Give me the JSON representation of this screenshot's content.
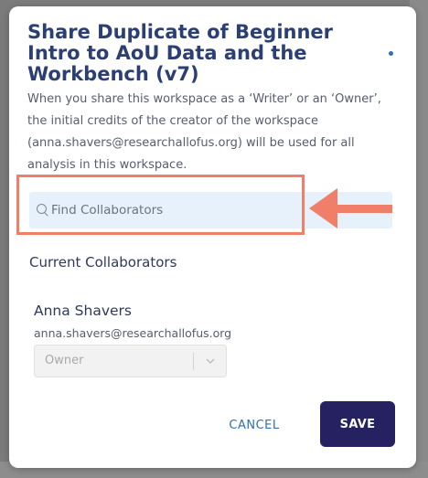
{
  "modal": {
    "title": "Share Duplicate of Beginner Intro to AoU Data and the Workbench (v7)",
    "description": "When you share this workspace as a ‘Writer’ or an ‘Owner’, the initial credits of the creator of the workspace (anna.shavers@researchallofus.org) will be used for all analysis in this workspace.",
    "search": {
      "placeholder": "Find Collaborators",
      "value": ""
    },
    "current_collaborators_heading": "Current Collaborators",
    "collaborators": [
      {
        "name": "Anna Shavers",
        "email": "anna.shavers@researchallofus.org",
        "role": "Owner"
      }
    ],
    "cancel_label": "CANCEL",
    "save_label": "SAVE"
  },
  "colors": {
    "title": "#2b3f74",
    "save_button": "#262262",
    "cancel_text": "#2f6fb5",
    "search_background": "#e6f1fb",
    "annotation": "#f07f69"
  },
  "icons": {
    "search": "search-icon",
    "dropdown": "chevron-down-icon"
  }
}
